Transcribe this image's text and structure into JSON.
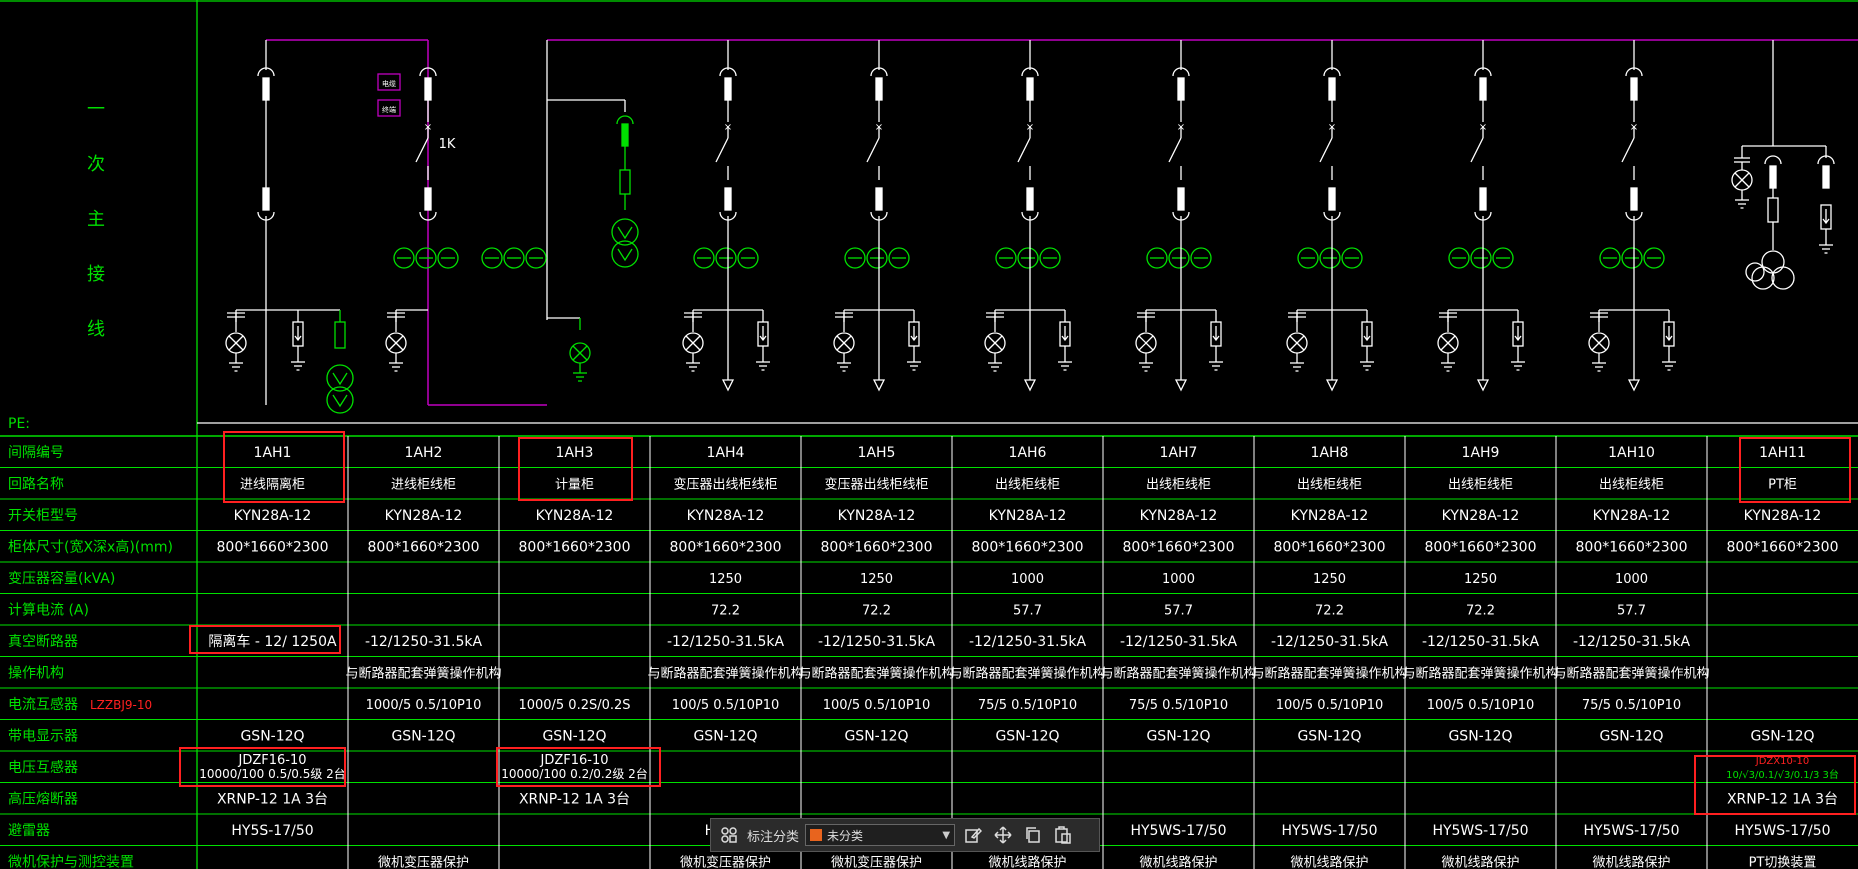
{
  "colors": {
    "bus": "#c000c0",
    "green": "#00e000",
    "line": "#ffffff",
    "red": "#ff2020",
    "highlight": "#ff2020",
    "bg": "#000000"
  },
  "side_title": [
    "一",
    "次",
    "主",
    "接",
    "线"
  ],
  "pe_label": "PE:",
  "labels": {
    "switch_1k": "1K",
    "box_a": "电缆",
    "box_b": "终端"
  },
  "row_labels": [
    "间隔编号",
    "回路名称",
    "开关柜型号",
    "柜体尺寸(宽X深x高)(mm)",
    "变压器容量(kVA)",
    "计算电流  (A)",
    "真空断路器",
    "操作机构",
    "电流互感器",
    "带电显示器",
    "电压互感器",
    "高压熔断器",
    "避雷器",
    "微机保护与测控装置"
  ],
  "ct_model": "LZZBJ9-10",
  "columns": [
    {
      "id": "1AH1",
      "name": "进线隔离柜",
      "model": "KYN28A-12",
      "size": "800*1660*2300",
      "kva": "",
      "current": "",
      "breaker": "隔离车 - 12/ 1250A",
      "mech": "",
      "ct": "",
      "indicator": "GSN-12Q",
      "pt": [
        "JDZF16-10",
        "10000/100 0.5/0.5级 2台"
      ],
      "fuse": "XRNP-12   1A   3台",
      "arrester": "HY5S-17/50",
      "protect": ""
    },
    {
      "id": "1AH2",
      "name": "进线柜线柜",
      "model": "KYN28A-12",
      "size": "800*1660*2300",
      "kva": "",
      "current": "",
      "breaker": "-12/1250-31.5kA",
      "mech": "与断路器配套弹簧操作机构",
      "ct": "1000/5 0.5/10P10",
      "indicator": "GSN-12Q",
      "pt": [],
      "fuse": "",
      "arrester": "",
      "protect": "微机变压器保护"
    },
    {
      "id": "1AH3",
      "name": "计量柜",
      "model": "KYN28A-12",
      "size": "800*1660*2300",
      "kva": "",
      "current": "",
      "breaker": "",
      "mech": "",
      "ct": "1000/5 0.2S/0.2S",
      "indicator": "GSN-12Q",
      "pt": [
        "JDZF16-10",
        "10000/100 0.2/0.2级 2台"
      ],
      "fuse": "XRNP-12   1A   3台",
      "arrester": "",
      "protect": ""
    },
    {
      "id": "1AH4",
      "name": "变压器出线柜线柜",
      "model": "KYN28A-12",
      "size": "800*1660*2300",
      "kva": "1250",
      "current": "72.2",
      "breaker": "-12/1250-31.5kA",
      "mech": "与断路器配套弹簧操作机构",
      "ct": "100/5 0.5/10P10",
      "indicator": "GSN-12Q",
      "pt": [],
      "fuse": "",
      "arrester": "HY5W",
      "protect": "微机变压器保护"
    },
    {
      "id": "1AH5",
      "name": "变压器出线柜线柜",
      "model": "KYN28A-12",
      "size": "800*1660*2300",
      "kva": "1250",
      "current": "72.2",
      "breaker": "-12/1250-31.5kA",
      "mech": "与断路器配套弹簧操作机构",
      "ct": "100/5 0.5/10P10",
      "indicator": "GSN-12Q",
      "pt": [],
      "fuse": "",
      "arrester": "",
      "protect": "微机变压器保护"
    },
    {
      "id": "1AH6",
      "name": "出线柜线柜",
      "model": "KYN28A-12",
      "size": "800*1660*2300",
      "kva": "1000",
      "current": "57.7",
      "breaker": "-12/1250-31.5kA",
      "mech": "与断路器配套弹簧操作机构",
      "ct": "75/5 0.5/10P10",
      "indicator": "GSN-12Q",
      "pt": [],
      "fuse": "",
      "arrester": "",
      "protect": "微机线路保护"
    },
    {
      "id": "1AH7",
      "name": "出线柜线柜",
      "model": "KYN28A-12",
      "size": "800*1660*2300",
      "kva": "1000",
      "current": "57.7",
      "breaker": "-12/1250-31.5kA",
      "mech": "与断路器配套弹簧操作机构",
      "ct": "75/5 0.5/10P10",
      "indicator": "GSN-12Q",
      "pt": [],
      "fuse": "",
      "arrester": "HY5WS-17/50",
      "protect": "微机线路保护"
    },
    {
      "id": "1AH8",
      "name": "出线柜线柜",
      "model": "KYN28A-12",
      "size": "800*1660*2300",
      "kva": "1250",
      "current": "72.2",
      "breaker": "-12/1250-31.5kA",
      "mech": "与断路器配套弹簧操作机构",
      "ct": "100/5 0.5/10P10",
      "indicator": "GSN-12Q",
      "pt": [],
      "fuse": "",
      "arrester": "HY5WS-17/50",
      "protect": "微机线路保护"
    },
    {
      "id": "1AH9",
      "name": "出线柜线柜",
      "model": "KYN28A-12",
      "size": "800*1660*2300",
      "kva": "1250",
      "current": "72.2",
      "breaker": "-12/1250-31.5kA",
      "mech": "与断路器配套弹簧操作机构",
      "ct": "100/5 0.5/10P10",
      "indicator": "GSN-12Q",
      "pt": [],
      "fuse": "",
      "arrester": "HY5WS-17/50",
      "protect": "微机线路保护"
    },
    {
      "id": "1AH10",
      "name": "出线柜线柜",
      "model": "KYN28A-12",
      "size": "800*1660*2300",
      "kva": "1000",
      "current": "57.7",
      "breaker": "-12/1250-31.5kA",
      "mech": "与断路器配套弹簧操作机构",
      "ct": "75/5 0.5/10P10",
      "indicator": "GSN-12Q",
      "pt": [],
      "fuse": "",
      "arrester": "HY5WS-17/50",
      "protect": "微机线路保护"
    },
    {
      "id": "1AH11",
      "name": "PT柜",
      "model": "KYN28A-12",
      "size": "800*1660*2300",
      "kva": "",
      "current": "",
      "breaker": "",
      "mech": "",
      "ct": "",
      "indicator": "GSN-12Q",
      "pt": [
        "JDZX10-10",
        "10/√3/0.1/√3/0.1/3  3台"
      ],
      "fuse": "XRNP-12   1A   3台",
      "arrester": "HY5WS-17/50",
      "protect": "PT切换装置"
    }
  ],
  "toolbar": {
    "label": "标注分类",
    "select_value": "未分类",
    "select_color": "#e8641e",
    "icons": [
      "grid-icon",
      "edit-icon",
      "move-icon",
      "copy-icon",
      "paste-icon"
    ]
  }
}
